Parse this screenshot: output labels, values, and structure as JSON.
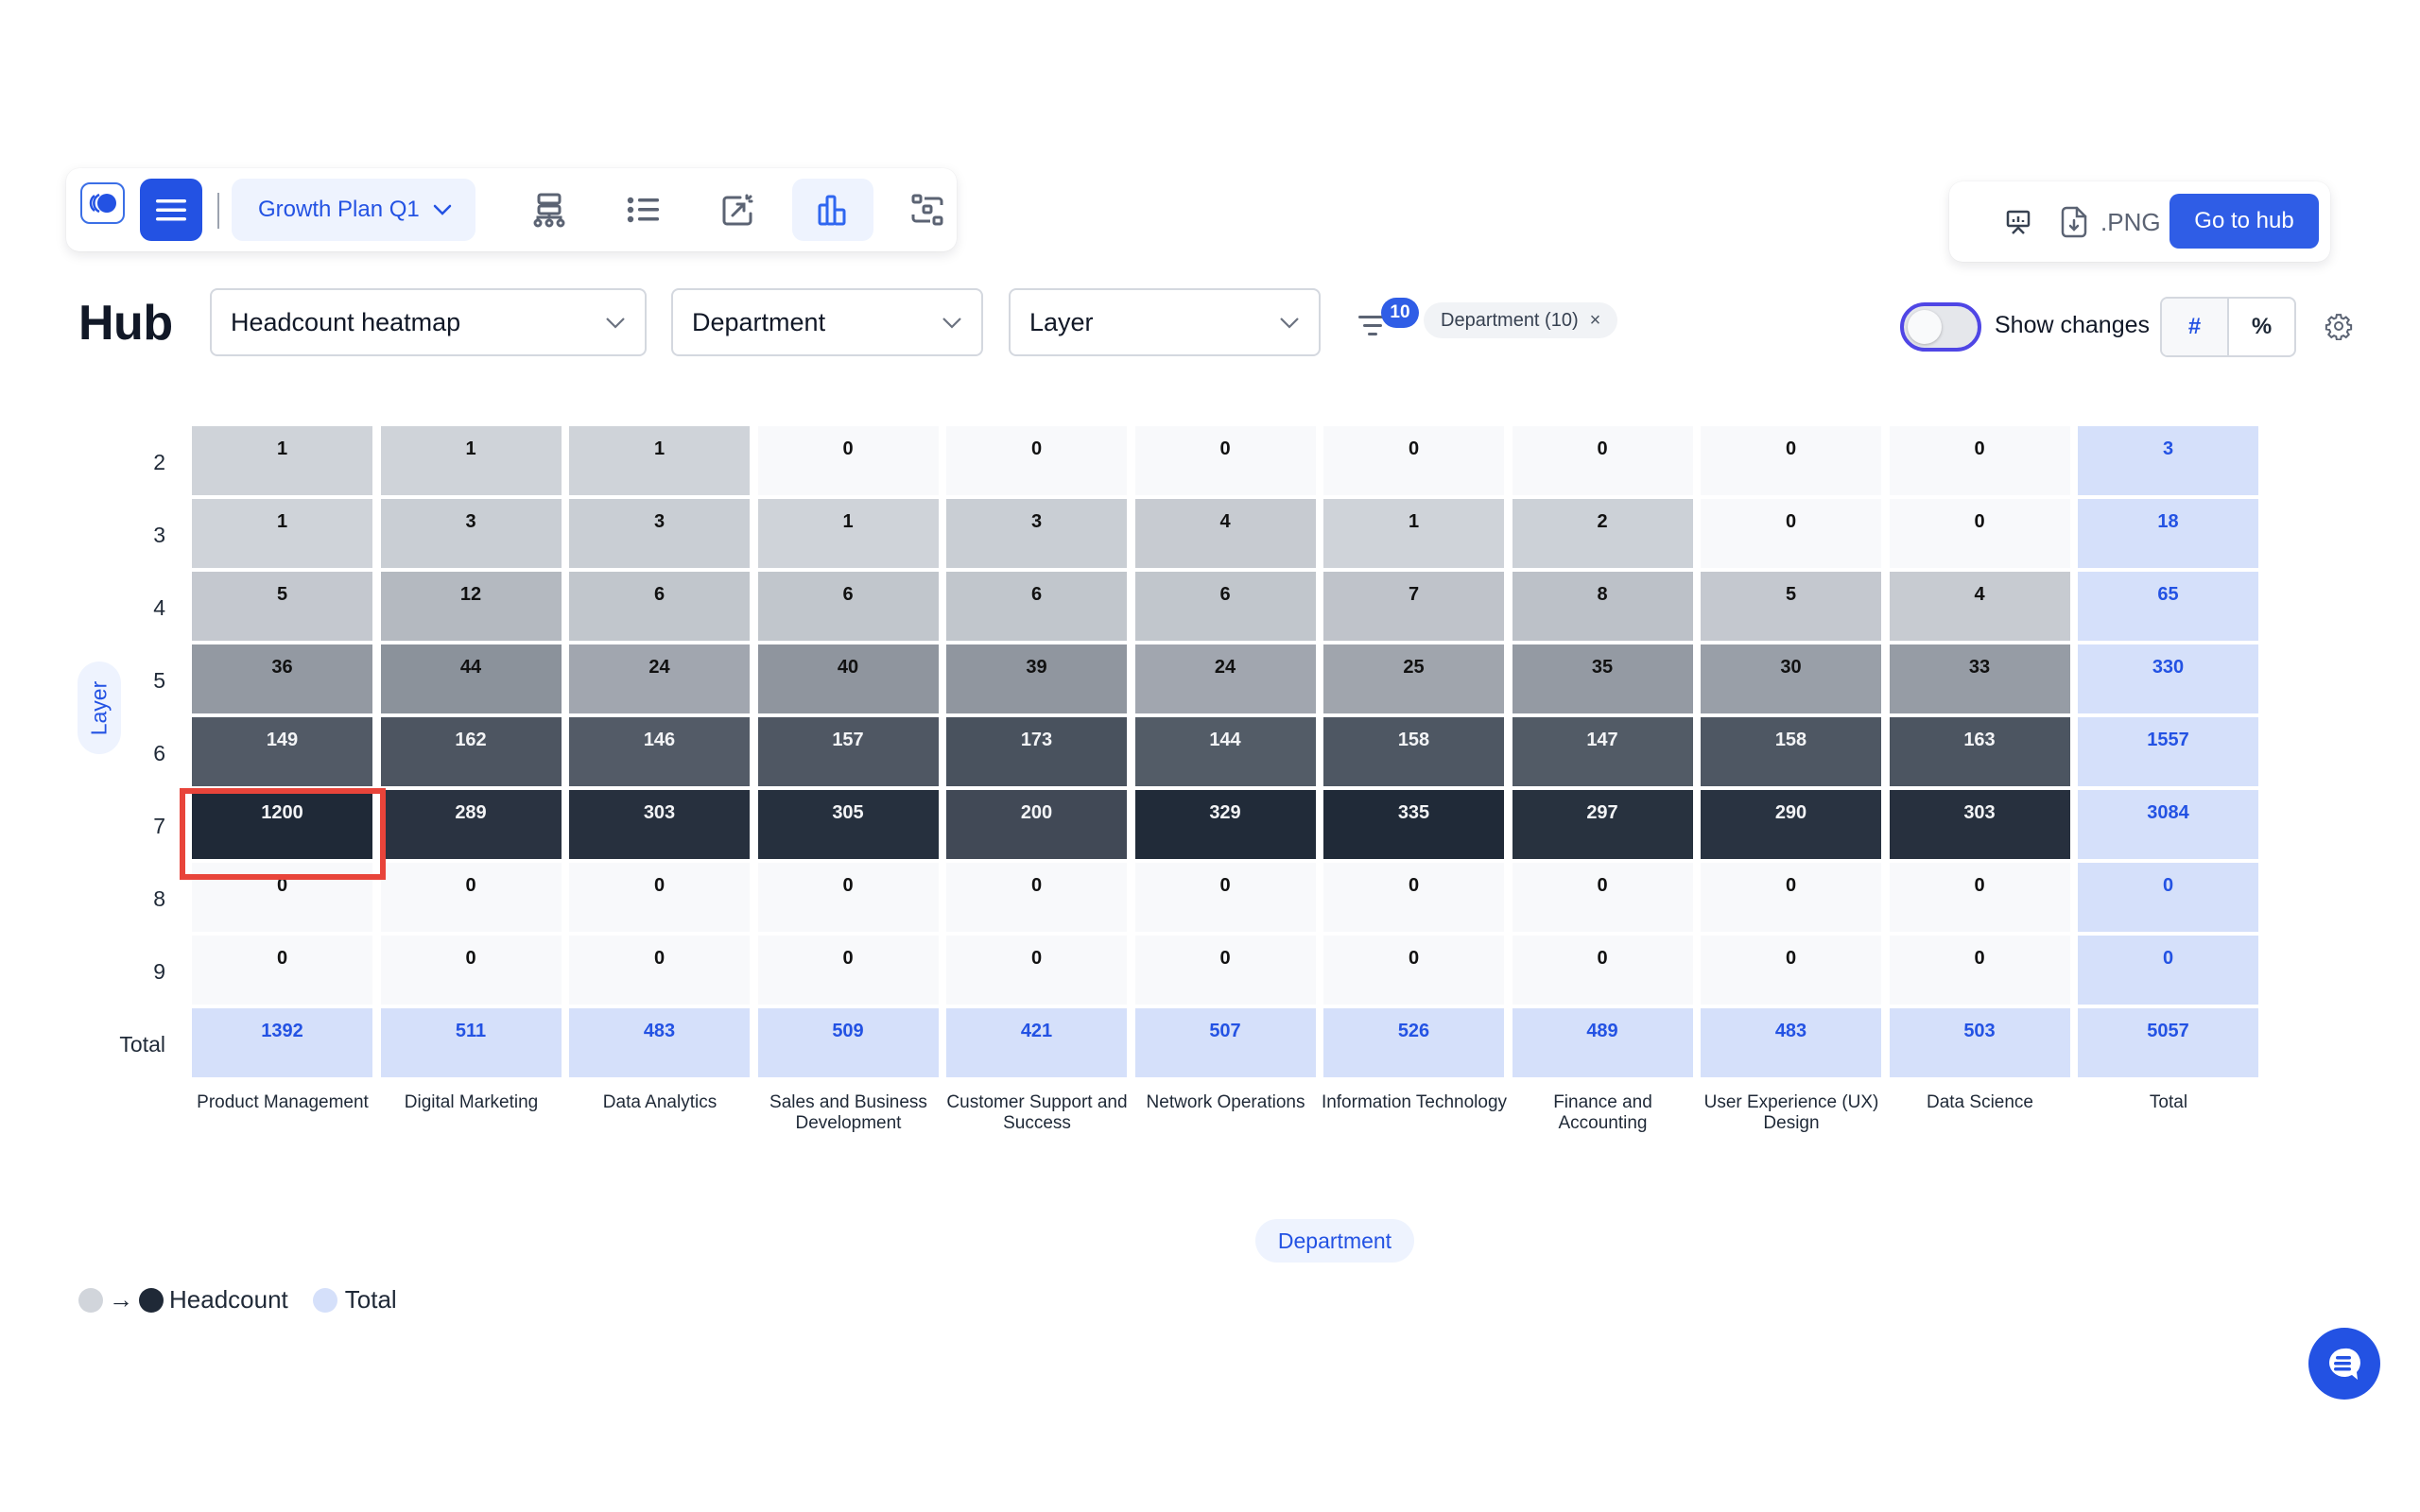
{
  "toolbar": {
    "plan_selector_label": "Growth Plan Q1",
    "icons": [
      "logo-icon",
      "menu-icon",
      "org-chart-icon",
      "list-icon",
      "export-chart-icon",
      "bar-chart-icon",
      "grid-layout-icon"
    ],
    "active_view": "bar-chart-icon"
  },
  "toolbar_right": {
    "png_label": ".PNG",
    "go_to_hub_label": "Go to hub"
  },
  "header": {
    "title": "Hub",
    "view_select": "Headcount heatmap",
    "column_select": "Department",
    "row_select": "Layer",
    "filter_count": "10",
    "filter_chip": "Department (10)",
    "show_changes_label": "Show changes",
    "show_changes_on": false,
    "mode_number": "#",
    "mode_percent": "%",
    "active_mode": "#"
  },
  "colors": {
    "accent": "#2352e3",
    "scale_low": "#d1d5db",
    "scale_high": "#1f2937",
    "total_fill": "#d5e0fa",
    "total_text": "#2352e3",
    "highlight": "#e8443a"
  },
  "chart_data": {
    "type": "heatmap",
    "title": "Headcount heatmap",
    "xlabel": "Department",
    "ylabel": "Layer",
    "rows": [
      "2",
      "3",
      "4",
      "5",
      "6",
      "7",
      "8",
      "9"
    ],
    "columns": [
      "Product Management",
      "Digital Marketing",
      "Data Analytics",
      "Sales and Business Development",
      "Customer Support and Success",
      "Network Operations",
      "Information Technology",
      "Finance and Accounting",
      "User Experience (UX) Design",
      "Data Science"
    ],
    "values": [
      [
        1,
        1,
        1,
        0,
        0,
        0,
        0,
        0,
        0,
        0
      ],
      [
        1,
        3,
        3,
        1,
        3,
        4,
        1,
        2,
        0,
        0
      ],
      [
        5,
        12,
        6,
        6,
        6,
        6,
        7,
        8,
        5,
        4
      ],
      [
        36,
        44,
        24,
        40,
        39,
        24,
        25,
        35,
        30,
        33
      ],
      [
        149,
        162,
        146,
        157,
        173,
        144,
        158,
        147,
        158,
        163
      ],
      [
        1200,
        289,
        303,
        305,
        200,
        329,
        335,
        297,
        290,
        303
      ],
      [
        0,
        0,
        0,
        0,
        0,
        0,
        0,
        0,
        0,
        0
      ],
      [
        0,
        0,
        0,
        0,
        0,
        0,
        0,
        0,
        0,
        0
      ]
    ],
    "row_totals": [
      3,
      18,
      65,
      330,
      1557,
      3084,
      0,
      0
    ],
    "column_totals": [
      1392,
      511,
      483,
      509,
      421,
      507,
      526,
      489,
      483,
      503
    ],
    "grand_total": 5057,
    "total_label": "Total",
    "highlighted_cell": {
      "row": "7",
      "column": "Product Management",
      "value": 1200
    },
    "legend": [
      {
        "label": "Headcount",
        "type": "gradient"
      },
      {
        "label": "Total",
        "type": "solid"
      }
    ]
  }
}
